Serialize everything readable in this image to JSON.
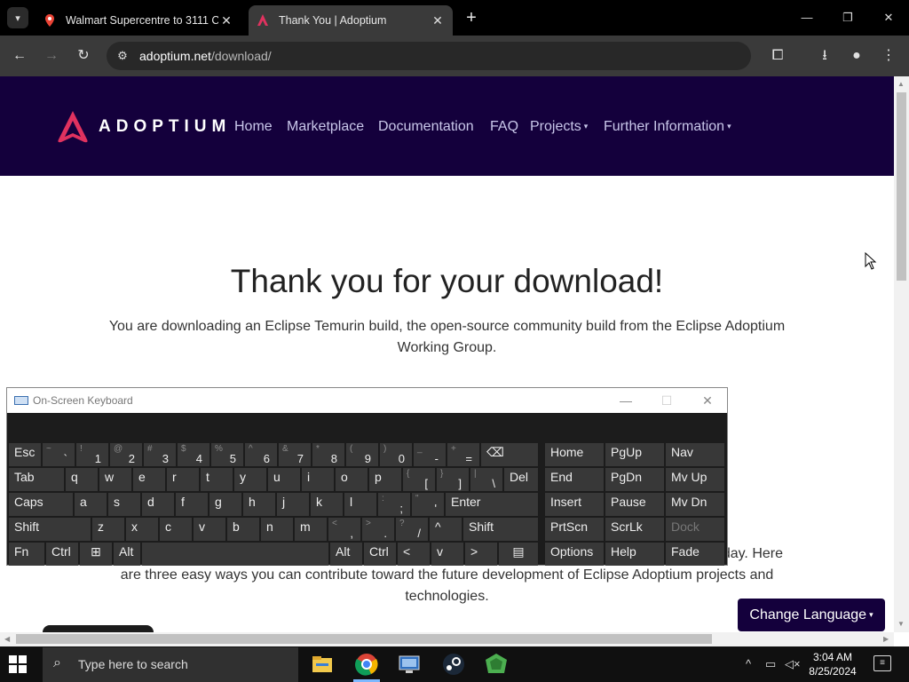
{
  "browser": {
    "tabs": [
      {
        "title": "Walmart Supercentre to 3111 C",
        "active": false
      },
      {
        "title": "Thank You | Adoptium",
        "active": true
      }
    ],
    "new_tab": "+",
    "url_host": "adoptium.net",
    "url_path": "/download/"
  },
  "site": {
    "brand": "ADOPTIUM",
    "nav": [
      "Home",
      "Marketplace",
      "Documentation",
      "FAQ",
      "Projects",
      "Further Information"
    ],
    "nav_caret": "▾",
    "heading": "Thank you for your download!",
    "lead": "You are downloading an Eclipse Temurin build, the open-source community build from the Eclipse Adoptium Working Group.",
    "lead2_line1_tail": "day. Here",
    "lead2_line2": "are three easy ways you can contribute toward the future development of Eclipse Adoptium projects and technologies.",
    "change_language": "Change Language",
    "colors": {
      "nav_bg": "#14003c",
      "accent": "#e0325f"
    }
  },
  "osk": {
    "title": "On-Screen Keyboard",
    "keys": {
      "esc": "Esc",
      "tab": "Tab",
      "caps": "Caps",
      "shift": "Shift",
      "fn": "Fn",
      "ctrl": "Ctrl",
      "alt": "Alt",
      "del": "Del",
      "enter": "Enter",
      "shift_r": "Shift",
      "alt_r": "Alt",
      "ctrl_r": "Ctrl",
      "home": "Home",
      "pgup": "PgUp",
      "nav": "Nav",
      "end": "End",
      "pgdn": "PgDn",
      "mvup": "Mv Up",
      "insert": "Insert",
      "pause": "Pause",
      "mvdn": "Mv Dn",
      "prtscn": "PrtScn",
      "scrlk": "ScrLk",
      "dock": "Dock",
      "options": "Options",
      "help": "Help",
      "fade": "Fade"
    },
    "row1": [
      [
        "~",
        "`"
      ],
      [
        "!",
        "1"
      ],
      [
        "@",
        "2"
      ],
      [
        "#",
        "3"
      ],
      [
        "$",
        "4"
      ],
      [
        "%",
        "5"
      ],
      [
        "^",
        "6"
      ],
      [
        "&",
        "7"
      ],
      [
        "*",
        "8"
      ],
      [
        "(",
        "9"
      ],
      [
        ")",
        "0"
      ],
      [
        "_",
        "-"
      ],
      [
        "+",
        "="
      ]
    ],
    "row2": [
      "q",
      "w",
      "e",
      "r",
      "t",
      "y",
      "u",
      "i",
      "o",
      "p"
    ],
    "row2_sym": [
      [
        "{",
        "["
      ],
      [
        "}",
        "]"
      ],
      [
        "|",
        "\\"
      ]
    ],
    "row3": [
      "a",
      "s",
      "d",
      "f",
      "g",
      "h",
      "j",
      "k",
      "l"
    ],
    "row3_sym": [
      [
        ":",
        ";"
      ],
      [
        "\"",
        "'"
      ]
    ],
    "row4": [
      "z",
      "x",
      "c",
      "v",
      "b",
      "n",
      "m"
    ],
    "row4_sym": [
      [
        "<",
        ","
      ],
      [
        ">",
        "."
      ],
      [
        "?",
        "/"
      ]
    ],
    "backspace": "⌫",
    "arrows": {
      "up": "^",
      "left": "<",
      "down": "v",
      "right": ">"
    }
  },
  "taskbar": {
    "search_placeholder": "Type here to search",
    "time": "3:04 AM",
    "date": "8/25/2024"
  }
}
